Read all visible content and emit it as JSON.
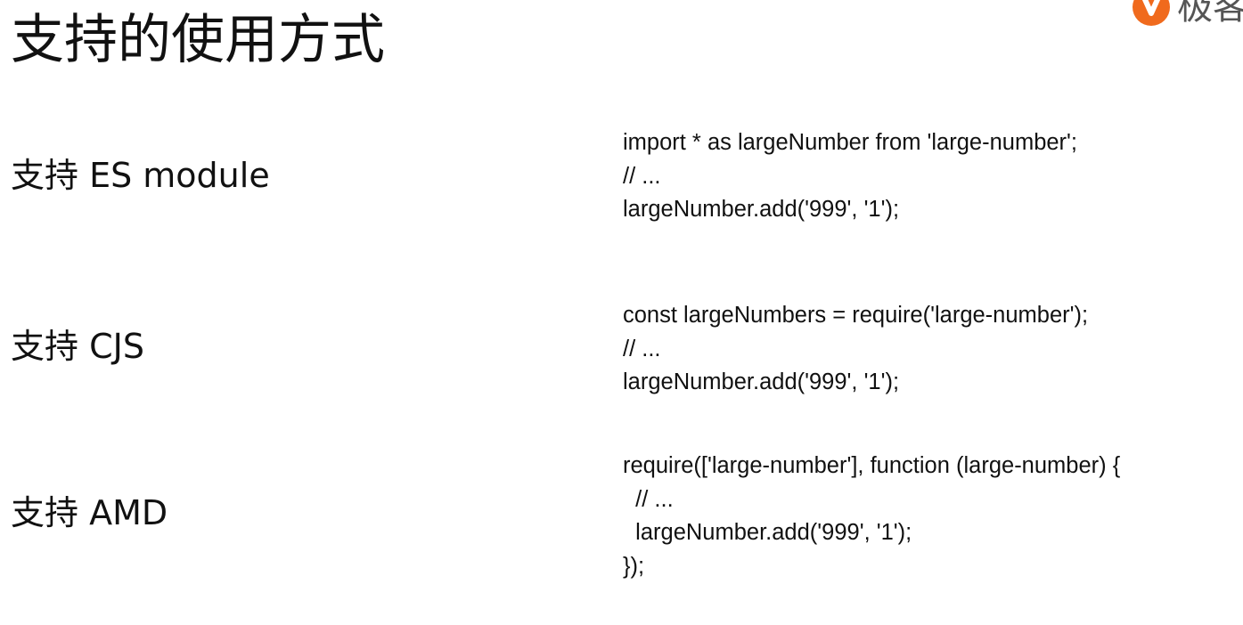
{
  "slide": {
    "title": "支持的使用方式",
    "brand": {
      "text": "极客",
      "accent_color": "#f06a1d"
    }
  },
  "sections": [
    {
      "label": "支持 ES module",
      "code": [
        "import * as largeNumber from 'large-number';",
        "// ...",
        "largeNumber.add('999', '1');"
      ]
    },
    {
      "label": "支持 CJS",
      "code": [
        "const largeNumbers = require('large-number');",
        "// ...",
        "largeNumber.add('999', '1');"
      ]
    },
    {
      "label": "支持 AMD",
      "code": [
        "require(['large-number'], function (large-number) {",
        "  // ...",
        "  largeNumber.add('999', '1');",
        "});"
      ]
    }
  ]
}
